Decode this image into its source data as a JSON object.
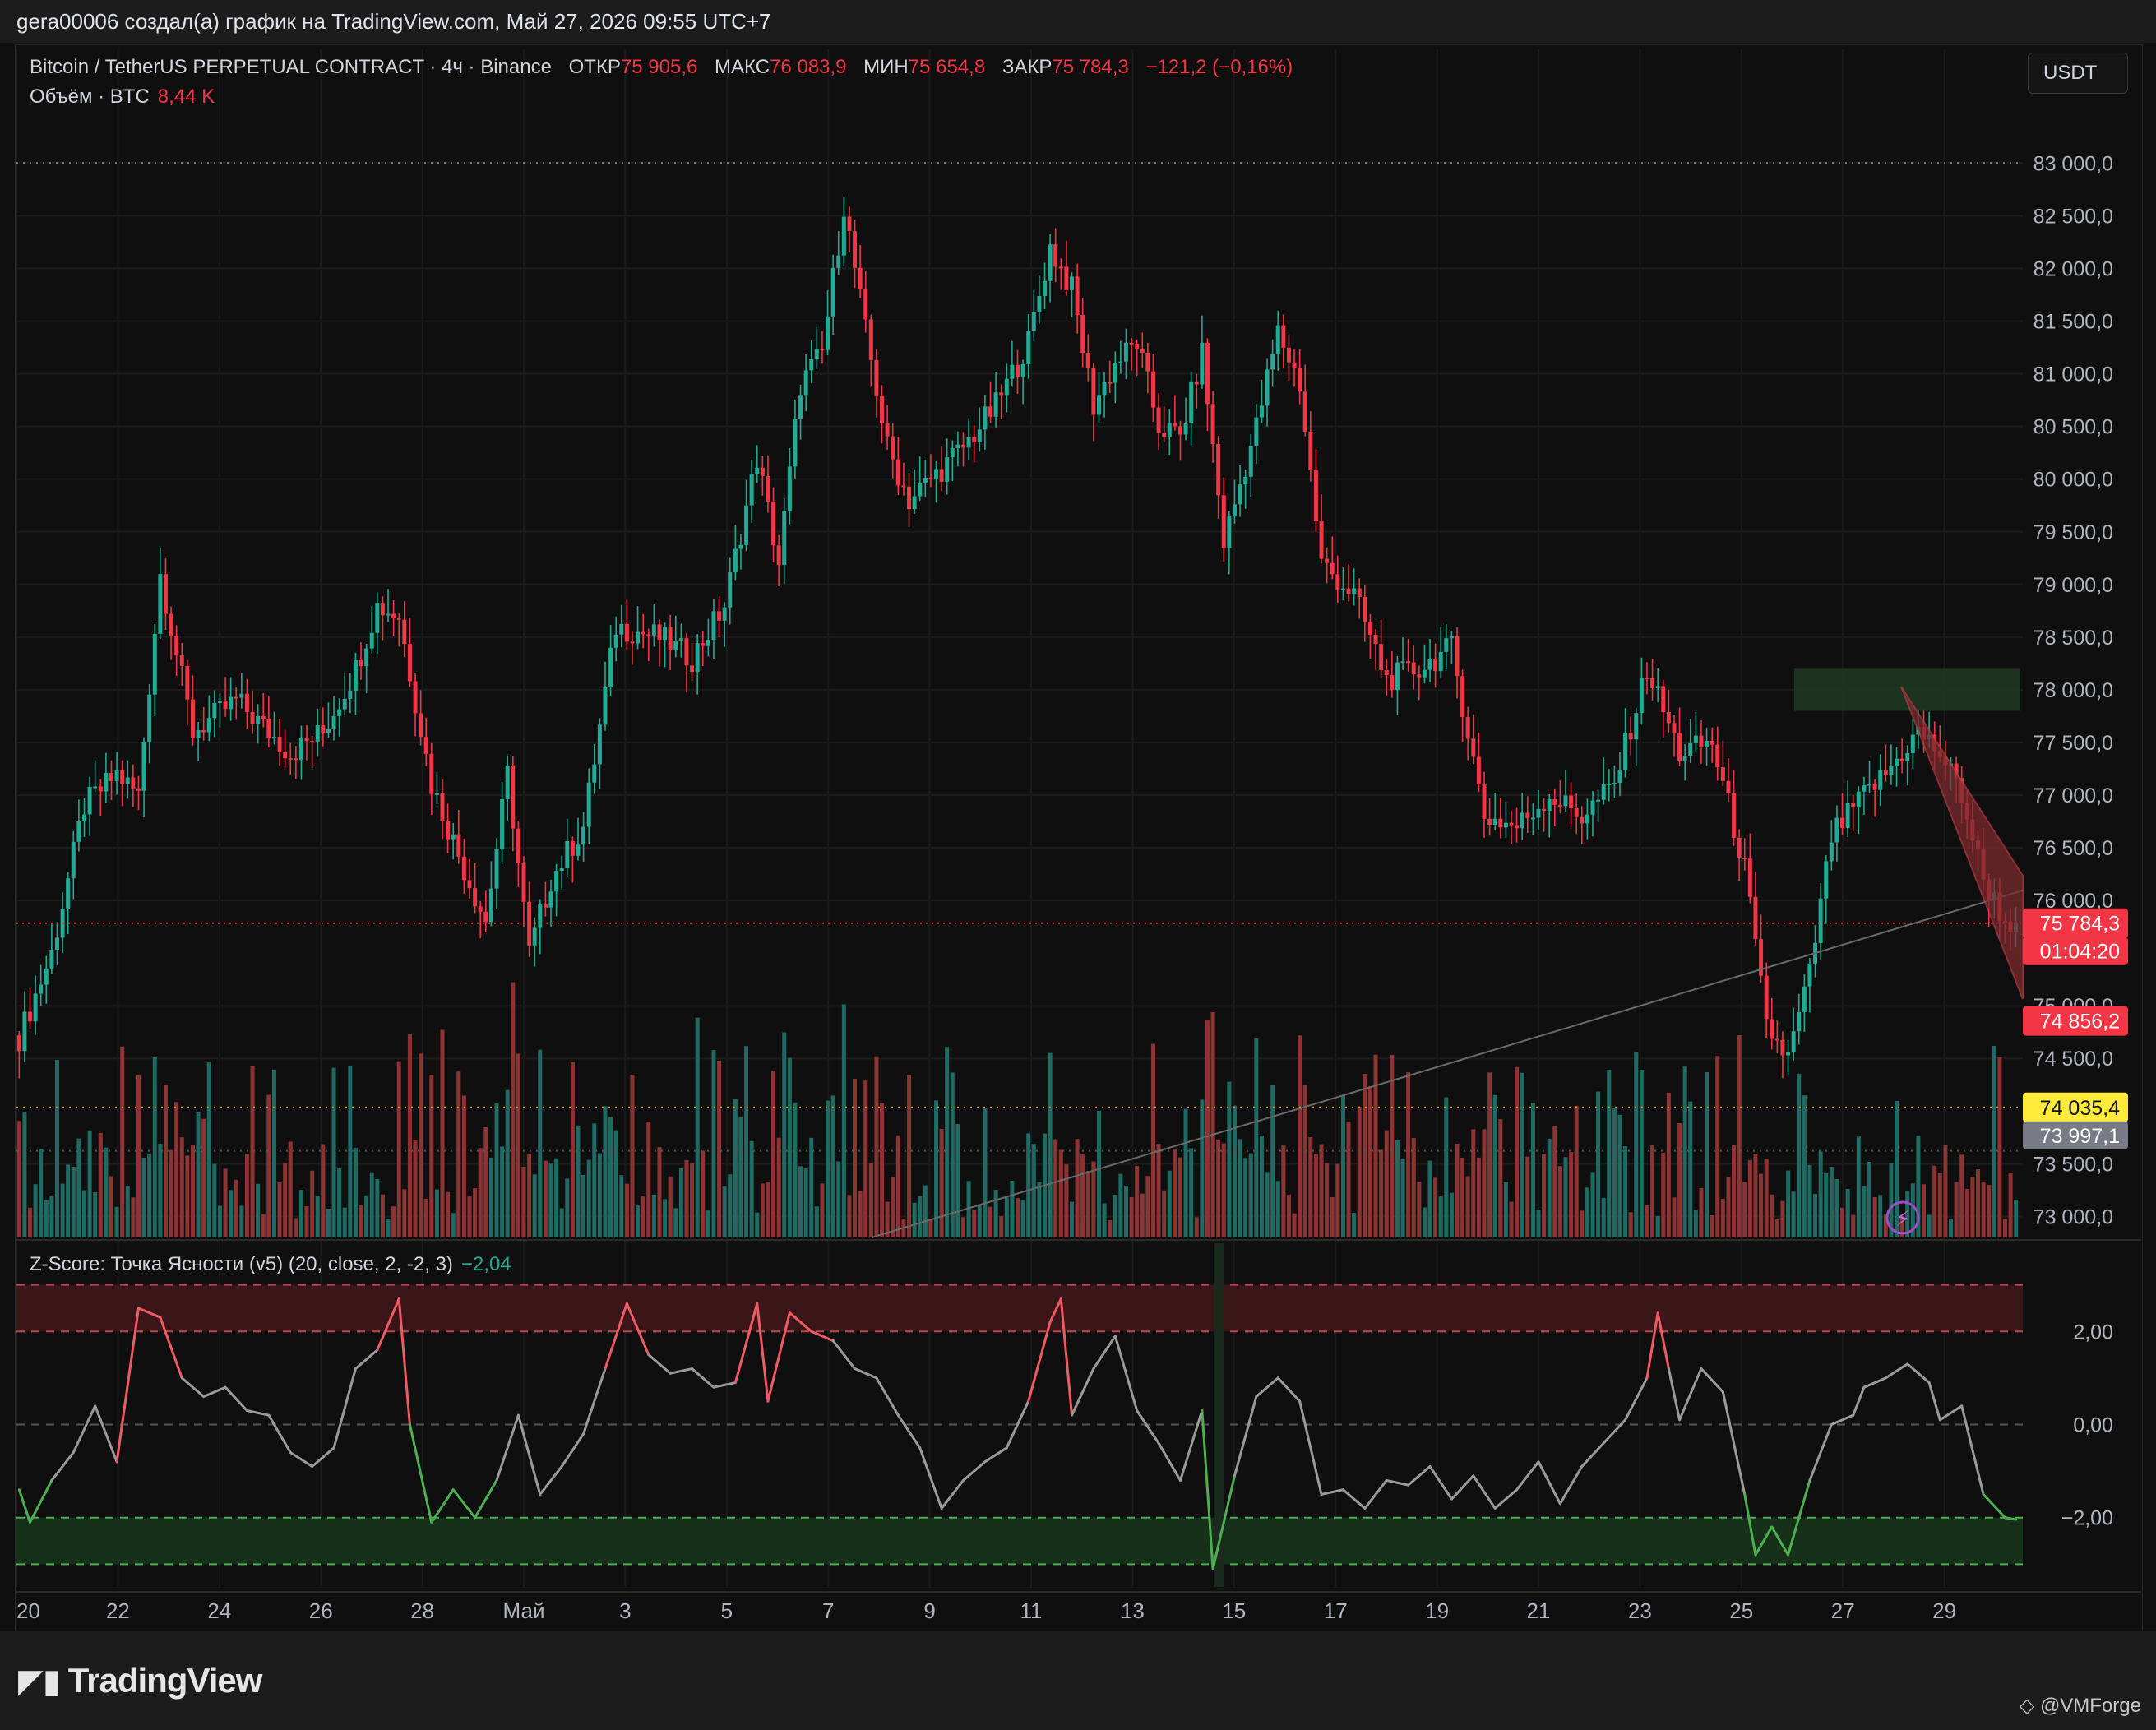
{
  "header": {
    "caption": "gera00006 создал(а) график на TradingView.com, Май 27, 2026 09:55 UTC+7"
  },
  "legend": {
    "symbol": "Bitcoin / TetherUS PERPETUAL CONTRACT · 4ч · Binance",
    "open_label": "ОТКР",
    "open": "75 905,6",
    "high_label": "МАКС",
    "high": "76 083,9",
    "low_label": "МИН",
    "low": "75 654,8",
    "close_label": "ЗАКР",
    "close": "75 784,3",
    "change": "−121,2 (−0,16%)",
    "volume_label": "Объём · BTC",
    "volume": "8,44 K"
  },
  "currency_button": "USDT",
  "indicator": {
    "title": "Z-Score: Точка Ясности (v5) (20, close, 2, -2, 3)",
    "value": "−2,04"
  },
  "price_tags": {
    "last_price": "75 784,3",
    "countdown": "01:04:20",
    "tag2": "74 856,2",
    "tag3": "74 035,4",
    "tag4": "73 997,1"
  },
  "colors": {
    "up": "#22ab94",
    "down": "#f23645",
    "up_volume": "#1f6b63",
    "down_volume": "#8c3434",
    "zscore_line": "#9a9a9a",
    "tag_yellow": "#ffeb3b",
    "tag_gray": "#787b86"
  },
  "footer": {
    "brand": "TradingView",
    "author": "@VMForge"
  },
  "chart_data": [
    {
      "type": "candlestick",
      "title": "Bitcoin / TetherUS PERPETUAL CONTRACT · 4ч · Binance",
      "y_ticks": [
        "73 000,0",
        "73 500,0",
        "74 500,0",
        "75 000,0",
        "76 000,0",
        "76 500,0",
        "77 000,0",
        "77 500,0",
        "78 000,0",
        "78 500,0",
        "79 000,0",
        "79 500,0",
        "80 000,0",
        "80 500,0",
        "81 000,0",
        "81 500,0",
        "82 000,0",
        "82 500,0",
        "83 000,0"
      ],
      "x_ticks": [
        "20",
        "22",
        "24",
        "26",
        "28",
        "Май",
        "3",
        "5",
        "7",
        "9",
        "11",
        "13",
        "15",
        "17",
        "19",
        "21",
        "23",
        "25",
        "27",
        "29"
      ],
      "ylim": [
        72800,
        83300
      ],
      "grid": true,
      "keypoints_close": [
        [
          0,
          74700
        ],
        [
          6,
          75500
        ],
        [
          12,
          76900
        ],
        [
          18,
          77200
        ],
        [
          22,
          77000
        ],
        [
          26,
          79100
        ],
        [
          32,
          77600
        ],
        [
          40,
          77900
        ],
        [
          50,
          77400
        ],
        [
          56,
          77600
        ],
        [
          62,
          78200
        ],
        [
          66,
          78800
        ],
        [
          70,
          78700
        ],
        [
          76,
          77100
        ],
        [
          82,
          76300
        ],
        [
          86,
          75800
        ],
        [
          90,
          77200
        ],
        [
          94,
          75500
        ],
        [
          98,
          76200
        ],
        [
          104,
          76700
        ],
        [
          110,
          78600
        ],
        [
          118,
          78500
        ],
        [
          124,
          78300
        ],
        [
          130,
          78800
        ],
        [
          136,
          80200
        ],
        [
          140,
          79200
        ],
        [
          144,
          80900
        ],
        [
          148,
          81200
        ],
        [
          152,
          82600
        ],
        [
          156,
          81400
        ],
        [
          160,
          80300
        ],
        [
          164,
          79800
        ],
        [
          168,
          80000
        ],
        [
          174,
          80300
        ],
        [
          180,
          80700
        ],
        [
          186,
          81300
        ],
        [
          190,
          82200
        ],
        [
          194,
          81800
        ],
        [
          198,
          80700
        ],
        [
          202,
          81100
        ],
        [
          206,
          81300
        ],
        [
          210,
          80500
        ],
        [
          214,
          80400
        ],
        [
          218,
          81200
        ],
        [
          222,
          79400
        ],
        [
          228,
          80500
        ],
        [
          232,
          81400
        ],
        [
          236,
          80900
        ],
        [
          240,
          79200
        ],
        [
          246,
          78900
        ],
        [
          252,
          78100
        ],
        [
          258,
          78200
        ],
        [
          264,
          78400
        ],
        [
          270,
          76800
        ],
        [
          276,
          76700
        ],
        [
          282,
          77000
        ],
        [
          288,
          76800
        ],
        [
          294,
          77100
        ],
        [
          300,
          78200
        ],
        [
          306,
          77400
        ],
        [
          312,
          77500
        ],
        [
          318,
          76300
        ],
        [
          322,
          74800
        ],
        [
          326,
          74500
        ],
        [
          330,
          75300
        ],
        [
          334,
          76600
        ],
        [
          340,
          77000
        ],
        [
          344,
          77200
        ],
        [
          350,
          77600
        ],
        [
          354,
          77400
        ],
        [
          358,
          77000
        ],
        [
          362,
          76200
        ],
        [
          366,
          75800
        ],
        [
          368,
          75784
        ]
      ],
      "volume_series_name": "Объём · BTC",
      "last_volume": "8,44 K"
    },
    {
      "type": "line",
      "title": "Z-Score: Точка Ясности (v5) (20, close, 2, -2, 3)",
      "y_ticks": [
        "2,00",
        "0,00",
        "−2,00"
      ],
      "ylim": [
        -3.4,
        3.4
      ],
      "bands": {
        "upper": [
          2,
          3
        ],
        "lower": [
          -3,
          -2
        ]
      },
      "last_value": -2.04,
      "keypoints": [
        [
          0,
          -1.4
        ],
        [
          2,
          -2.1
        ],
        [
          6,
          -1.2
        ],
        [
          10,
          -0.6
        ],
        [
          14,
          0.4
        ],
        [
          18,
          -0.8
        ],
        [
          22,
          2.5
        ],
        [
          26,
          2.3
        ],
        [
          30,
          1.0
        ],
        [
          34,
          0.6
        ],
        [
          38,
          0.8
        ],
        [
          42,
          0.3
        ],
        [
          46,
          0.2
        ],
        [
          50,
          -0.6
        ],
        [
          54,
          -0.9
        ],
        [
          58,
          -0.5
        ],
        [
          62,
          1.2
        ],
        [
          66,
          1.6
        ],
        [
          70,
          2.7
        ],
        [
          72,
          0.0
        ],
        [
          76,
          -2.1
        ],
        [
          80,
          -1.4
        ],
        [
          84,
          -2.0
        ],
        [
          88,
          -1.2
        ],
        [
          92,
          0.2
        ],
        [
          96,
          -1.5
        ],
        [
          100,
          -0.9
        ],
        [
          104,
          -0.2
        ],
        [
          108,
          1.2
        ],
        [
          112,
          2.6
        ],
        [
          116,
          1.5
        ],
        [
          120,
          1.1
        ],
        [
          124,
          1.2
        ],
        [
          128,
          0.8
        ],
        [
          132,
          0.9
        ],
        [
          136,
          2.6
        ],
        [
          138,
          0.5
        ],
        [
          142,
          2.4
        ],
        [
          146,
          2.0
        ],
        [
          150,
          1.8
        ],
        [
          154,
          1.2
        ],
        [
          158,
          1.0
        ],
        [
          162,
          0.2
        ],
        [
          166,
          -0.5
        ],
        [
          170,
          -1.8
        ],
        [
          174,
          -1.2
        ],
        [
          178,
          -0.8
        ],
        [
          182,
          -0.5
        ],
        [
          186,
          0.5
        ],
        [
          190,
          2.2
        ],
        [
          192,
          2.7
        ],
        [
          194,
          0.2
        ],
        [
          198,
          1.2
        ],
        [
          202,
          1.9
        ],
        [
          206,
          0.3
        ],
        [
          210,
          -0.4
        ],
        [
          214,
          -1.2
        ],
        [
          218,
          0.3
        ],
        [
          220,
          -3.1
        ],
        [
          224,
          -1.1
        ],
        [
          228,
          0.6
        ],
        [
          232,
          1.0
        ],
        [
          236,
          0.5
        ],
        [
          240,
          -1.5
        ],
        [
          244,
          -1.4
        ],
        [
          248,
          -1.8
        ],
        [
          252,
          -1.2
        ],
        [
          256,
          -1.3
        ],
        [
          260,
          -0.9
        ],
        [
          264,
          -1.6
        ],
        [
          268,
          -1.1
        ],
        [
          272,
          -1.8
        ],
        [
          276,
          -1.4
        ],
        [
          280,
          -0.8
        ],
        [
          284,
          -1.7
        ],
        [
          288,
          -0.9
        ],
        [
          292,
          -0.4
        ],
        [
          296,
          0.1
        ],
        [
          300,
          1.0
        ],
        [
          302,
          2.4
        ],
        [
          304,
          1.2
        ],
        [
          306,
          0.1
        ],
        [
          310,
          1.2
        ],
        [
          314,
          0.7
        ],
        [
          318,
          -1.5
        ],
        [
          320,
          -2.8
        ],
        [
          323,
          -2.2
        ],
        [
          326,
          -2.8
        ],
        [
          330,
          -1.2
        ],
        [
          334,
          0.0
        ],
        [
          338,
          0.2
        ],
        [
          340,
          0.8
        ],
        [
          344,
          1.0
        ],
        [
          348,
          1.3
        ],
        [
          352,
          0.9
        ],
        [
          354,
          0.1
        ],
        [
          358,
          0.4
        ],
        [
          362,
          -1.5
        ],
        [
          366,
          -2.0
        ],
        [
          368,
          -2.04
        ]
      ]
    }
  ]
}
